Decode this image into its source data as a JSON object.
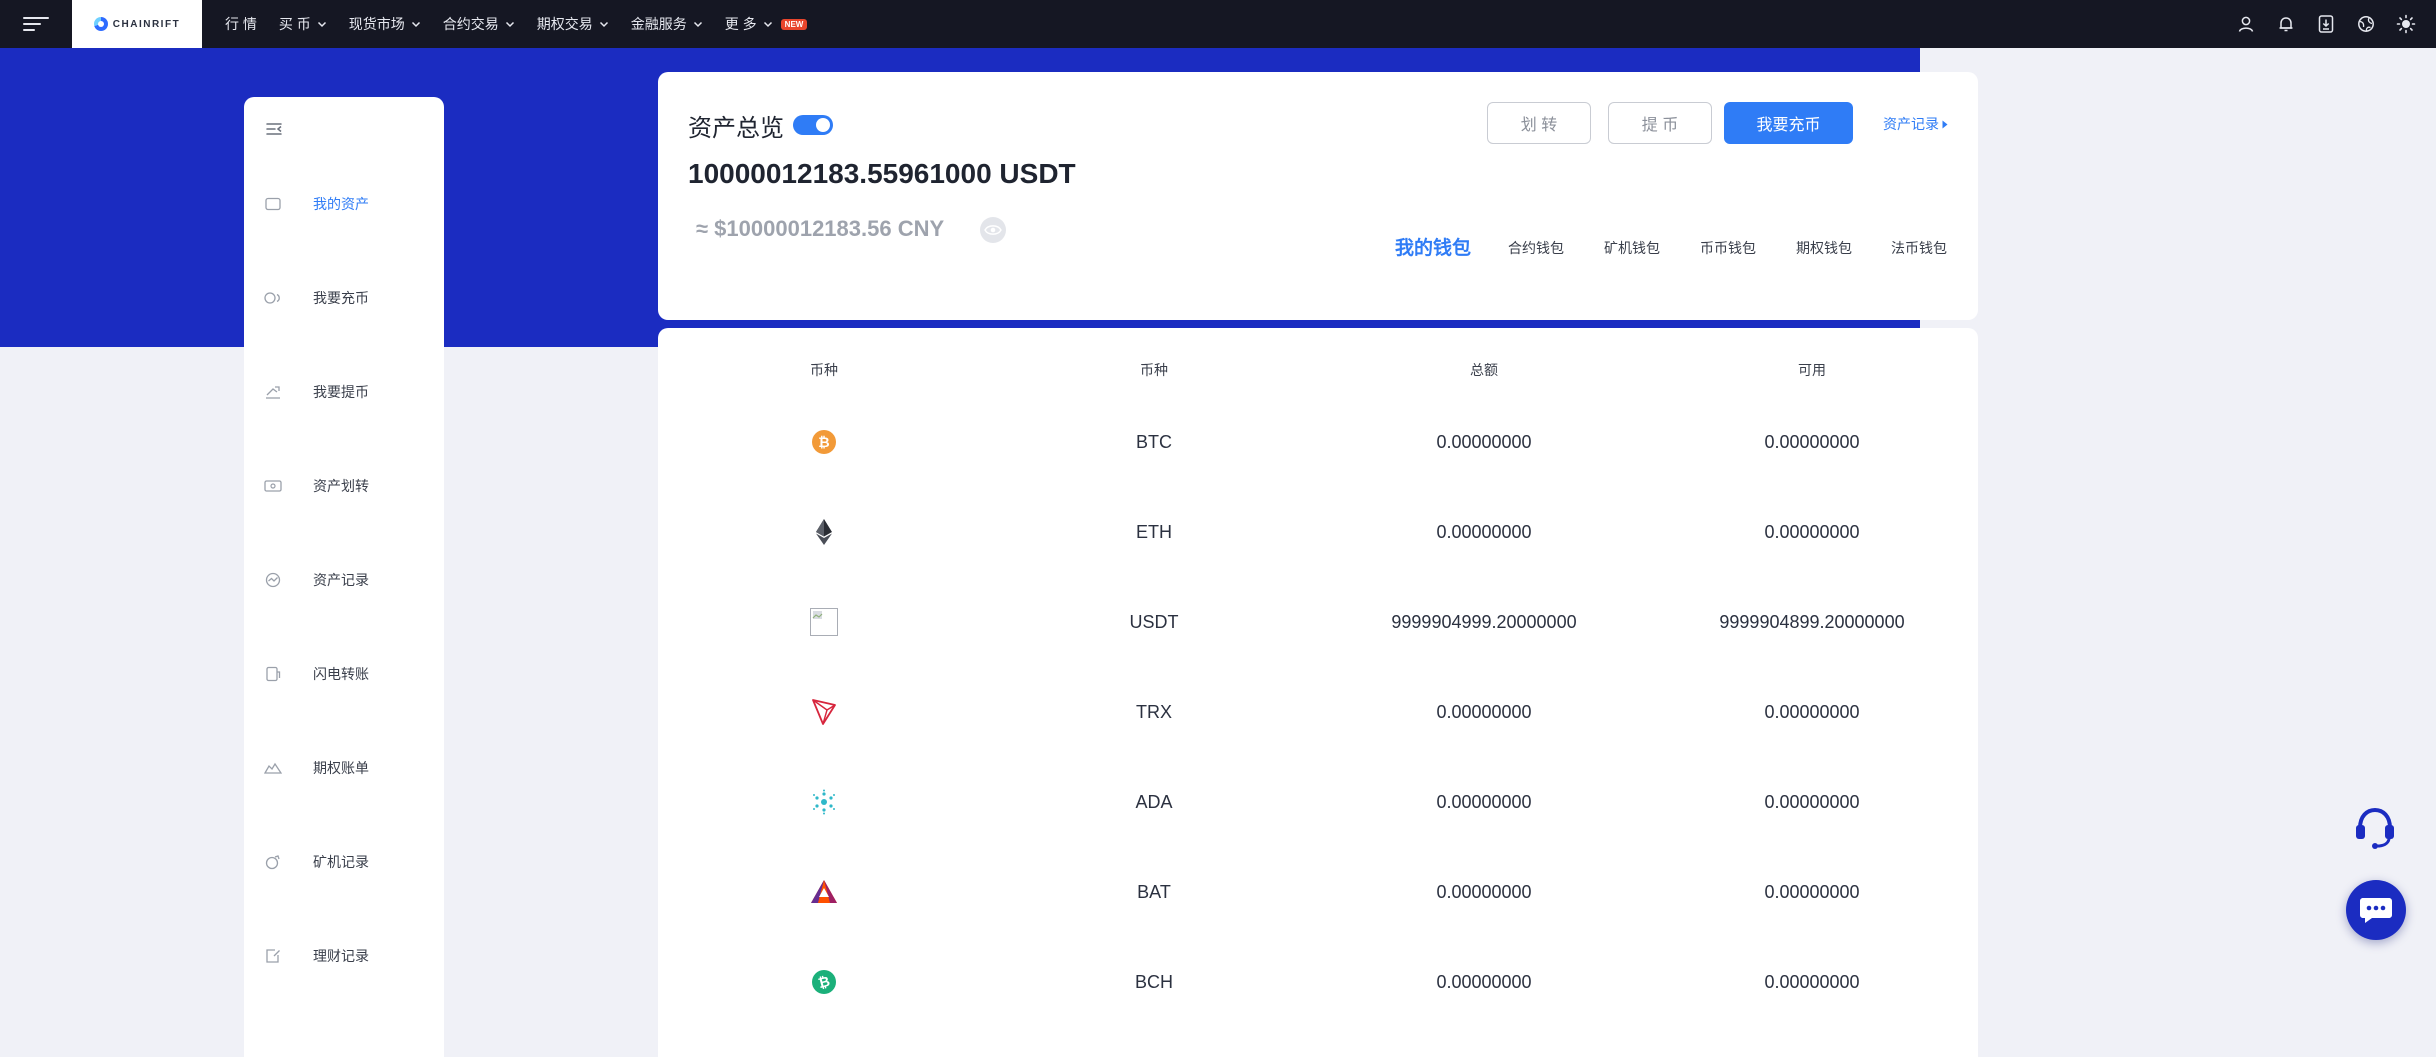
{
  "colors": {
    "nav_bg": "#151723",
    "hero_blue": "#1b2cc1",
    "accent": "#2f7cf6",
    "page_bg": "#f0f1f7",
    "badge_new": "#e8452c"
  },
  "header": {
    "logo_text": "CHAINRIFT",
    "nav": [
      {
        "label": "行 情",
        "dropdown": false
      },
      {
        "label": "买 币",
        "dropdown": true
      },
      {
        "label": "现货市场",
        "dropdown": true
      },
      {
        "label": "合约交易",
        "dropdown": true
      },
      {
        "label": "期权交易",
        "dropdown": true
      },
      {
        "label": "金融服务",
        "dropdown": true
      },
      {
        "label": "更 多",
        "dropdown": true,
        "badge": "NEW"
      }
    ],
    "icons": [
      "user-icon",
      "bell-icon",
      "download-icon",
      "globe-icon",
      "theme-sun-icon"
    ]
  },
  "sidebar": {
    "items": [
      {
        "label": "我的资产",
        "icon": "wallet-icon",
        "active": true
      },
      {
        "label": "我要充币",
        "icon": "deposit-icon",
        "active": false
      },
      {
        "label": "我要提币",
        "icon": "withdraw-icon",
        "active": false
      },
      {
        "label": "资产划转",
        "icon": "transfer-icon",
        "active": false
      },
      {
        "label": "资产记录",
        "icon": "records-icon",
        "active": false
      },
      {
        "label": "闪电转账",
        "icon": "flash-transfer-icon",
        "active": false
      },
      {
        "label": "期权账单",
        "icon": "options-bill-icon",
        "active": false
      },
      {
        "label": "矿机记录",
        "icon": "miner-icon",
        "active": false
      },
      {
        "label": "理财记录",
        "icon": "finance-icon",
        "active": false
      }
    ]
  },
  "overview": {
    "title": "资产总览",
    "total_usdt": "10000012183.55961000 USDT",
    "total_cny": "≈ $10000012183.56 CNY",
    "buttons": {
      "transfer": "划 转",
      "withdraw": "提 币",
      "deposit": "我要充币"
    },
    "asset_record_link": "资产记录",
    "wallet_tabs": [
      "我的钱包",
      "合约钱包",
      "矿机钱包",
      "币币钱包",
      "期权钱包",
      "法币钱包"
    ]
  },
  "table": {
    "headers": [
      "币种",
      "币种",
      "总额",
      "可用"
    ],
    "rows": [
      {
        "icon": "btc-icon",
        "symbol": "BTC",
        "total": "0.00000000",
        "available": "0.00000000"
      },
      {
        "icon": "eth-icon",
        "symbol": "ETH",
        "total": "0.00000000",
        "available": "0.00000000"
      },
      {
        "icon": "usdt-broken-image-icon",
        "symbol": "USDT",
        "total": "9999904999.20000000",
        "available": "9999904899.20000000"
      },
      {
        "icon": "trx-icon",
        "symbol": "TRX",
        "total": "0.00000000",
        "available": "0.00000000"
      },
      {
        "icon": "ada-icon",
        "symbol": "ADA",
        "total": "0.00000000",
        "available": "0.00000000"
      },
      {
        "icon": "bat-icon",
        "symbol": "BAT",
        "total": "0.00000000",
        "available": "0.00000000"
      },
      {
        "icon": "bch-icon",
        "symbol": "BCH",
        "total": "0.00000000",
        "available": "0.00000000"
      }
    ]
  },
  "floating": {
    "support_icon": "headset-icon",
    "chat_icon": "chat-bubble-icon"
  }
}
